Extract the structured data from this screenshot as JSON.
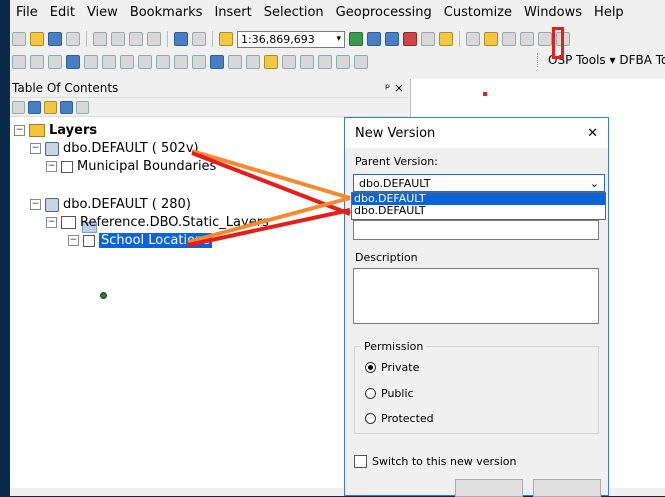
{
  "menu": [
    "File",
    "Edit",
    "View",
    "Bookmarks",
    "Insert",
    "Selection",
    "Geoprocessing",
    "Customize",
    "Windows",
    "Help"
  ],
  "toolbar": {
    "scale": "1:36,869,693",
    "osp_tools": "OSP Tools ▾",
    "dfba_tools": "DFBA Too"
  },
  "toc": {
    "title": "Table Of Contents",
    "pin_icon": "ᵖ",
    "close_icon": "×",
    "root_label": "Layers",
    "db1_label": "dbo.DEFAULT (      502v)",
    "layer_municipal": "Municipal Boundaries",
    "db2_label": "dbo.DEFAULT (      280)",
    "group_label": "Reference.DBO.Static_Layers",
    "layer_school": "School Locations"
  },
  "dialog": {
    "title": "New Version",
    "close": "✕",
    "parent_label": "Parent Version:",
    "selected": "dbo.DEFAULT",
    "options": [
      "dbo.DEFAULT",
      "dbo.DEFAULT"
    ],
    "description_label": "Description",
    "permission_label": "Permission",
    "permissions": [
      "Private",
      "Public",
      "Protected"
    ],
    "switch_label": "Switch to this new version"
  },
  "colors": {
    "selection": "#0a64d6",
    "annotation_red": "#e41d1d",
    "annotation_orange": "#f58a2e"
  }
}
